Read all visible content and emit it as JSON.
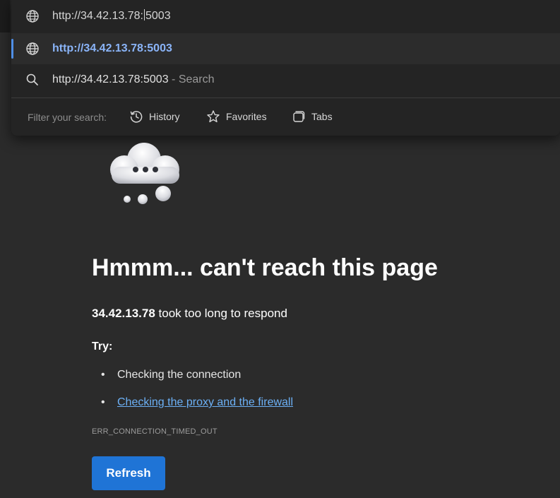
{
  "address_bar": {
    "typed_text_before_caret": "http://34.42.13.78:",
    "typed_text_after_caret": "5003",
    "icon": "globe-icon"
  },
  "suggestions": [
    {
      "icon": "globe-icon",
      "text": "http://34.42.13.78:5003"
    },
    {
      "icon": "search-icon",
      "text": "http://34.42.13.78:5003",
      "hint": "- Search"
    }
  ],
  "filter": {
    "label": "Filter your search:",
    "chips": [
      {
        "icon": "history-icon",
        "label": "History"
      },
      {
        "icon": "star-icon",
        "label": "Favorites"
      },
      {
        "icon": "tabs-icon",
        "label": "Tabs"
      }
    ]
  },
  "error_page": {
    "illustration": "thinking-cloud-icon",
    "title": "Hmmm... can't reach this page",
    "host": "34.42.13.78",
    "message": "took too long to respond",
    "try_label": "Try:",
    "suggestions": [
      "Checking the connection",
      "Checking the proxy and the firewall"
    ],
    "error_code": "ERR_CONNECTION_TIMED_OUT",
    "refresh_label": "Refresh"
  },
  "colors": {
    "background": "#2b2b2b",
    "link": "#6cb0f5",
    "accent": "#1f74d6",
    "suggestion_highlight": "#8ab4f8"
  }
}
